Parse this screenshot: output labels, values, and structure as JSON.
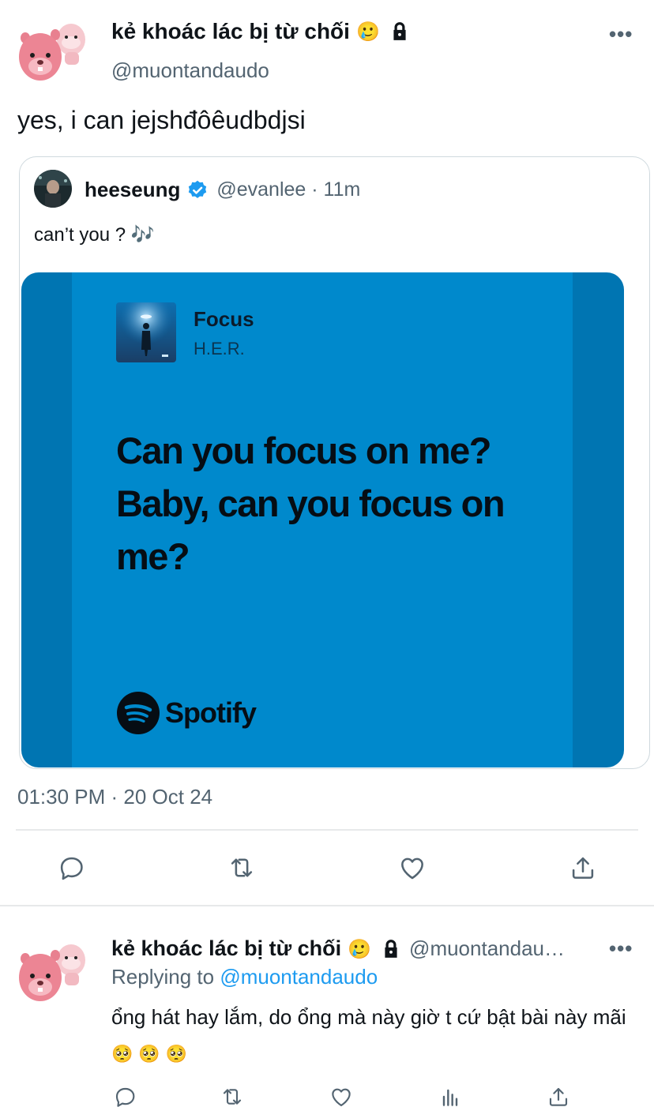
{
  "main_tweet": {
    "display_name": "kẻ khoác lác bị từ chối",
    "name_emoji": "🥲",
    "handle": "@muontandaudo",
    "text": "yes, i can jejshđôêudbdjsi",
    "more_label": "•••",
    "timestamp": "01:30 PM · 20 Oct 24"
  },
  "quote": {
    "display_name": "heeseung",
    "handle_time": "@evanlee · 11m",
    "text": "can’t you ? 🎶",
    "media": {
      "song_title": "Focus",
      "artist": "H.E.R.",
      "lyrics": "Can you focus on me? Baby, can you focus on me?",
      "brand": "Spotify",
      "background": "#0089cc"
    }
  },
  "reply": {
    "display_name": "kẻ khoác lác bị từ chối",
    "name_emoji": "🥲",
    "handle": "@muontandau…",
    "more_label": "•••",
    "replying_prefix": "Replying to",
    "replying_to": "@muontandaudo",
    "text": "ổng hát hay lắm, do ổng mà này giờ t cứ bật bài này mãi",
    "emojis": "🥺 🥺 🥺"
  },
  "colors": {
    "accent": "#1d9bf0",
    "secondary_text": "#536471",
    "divider": "#e7e9ea"
  },
  "icons": [
    "reply-icon",
    "retweet-icon",
    "like-icon",
    "share-icon",
    "analytics-icon",
    "lock-icon",
    "verified-icon",
    "more-icon"
  ]
}
